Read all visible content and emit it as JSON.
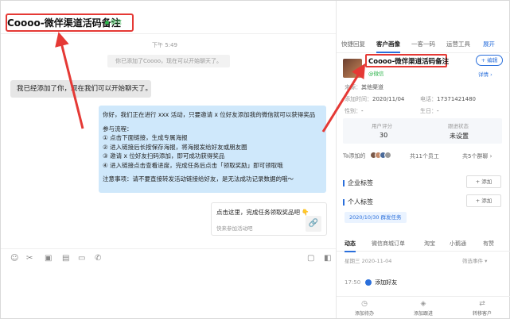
{
  "chat": {
    "title": "Coooo-微伴渠道活码备注",
    "badge": "微信",
    "time": "下午 5:49",
    "system_message": "你已添加了Coooo，现在可以开始聊天了。",
    "left_message": "我已经添加了你，现在我们可以开始聊天了。",
    "right_message_lines": [
      "你好，我们正在进行 xxx 活动，只要邀请 x 位好友添加我的微信就可以获得奖品",
      "",
      "参与流程：",
      "① 点击下面链接，生成专属海报",
      "② 进入链接后长按保存海报，将海报发给好友或朋友圈",
      "③ 邀请 x 位好友扫码添加，即可成功获得奖品",
      "④ 进入链接点击查看进度，完成任务后点击「领取奖励」即可领取哦",
      "",
      "注意事项：请不要直接转发活动链接给好友，是无法成功记录数据的哦～"
    ],
    "link_card": {
      "title": "点击这里，完成任务领取奖品吧",
      "hand": "👇",
      "subtitle": "快来参加活动吧"
    }
  },
  "panel": {
    "tabs": [
      "快捷回复",
      "客户画像",
      "一客一码",
      "运营工具",
      "展开"
    ],
    "active_tab": "客户画像",
    "customer_name": "Coooo-微伴渠道活码备注",
    "wx_badge": "@微信",
    "edit_label": "+ 编辑",
    "detail_label": "详情 ›",
    "source_label": "来源：",
    "source_value": "其他渠道",
    "added_label": "添加时间：",
    "added_value": "2020/11/04",
    "phone_label": "电话：",
    "phone_value": "17371421480",
    "gender_label": "性别：",
    "gender_value": "-",
    "birthday_label": "生日：",
    "birthday_value": "-",
    "stats": [
      {
        "label": "用户评分",
        "value": "30"
      },
      {
        "label": "跟进状态",
        "value": "未设置"
      }
    ],
    "ta_label": "Ta添加的",
    "ta_count": "共11个员工",
    "ta_groups": "共5个群聊 ›",
    "company_tag_label": "企业标签",
    "personal_tag_label": "个人标签",
    "add_label": "+ 添加",
    "tag": "2020/10/30 群发任务",
    "subtabs": [
      "动态",
      "微信商城订单",
      "淘宝",
      "小鹅通",
      "有赞"
    ],
    "date_row": "星期三  2020-11-04",
    "filter_label": "筛选事件 ▾",
    "event_time": "17:50",
    "event_label": "添加好友",
    "bottom_actions": [
      "添加待办",
      "添加跟进",
      "转移客户"
    ]
  }
}
